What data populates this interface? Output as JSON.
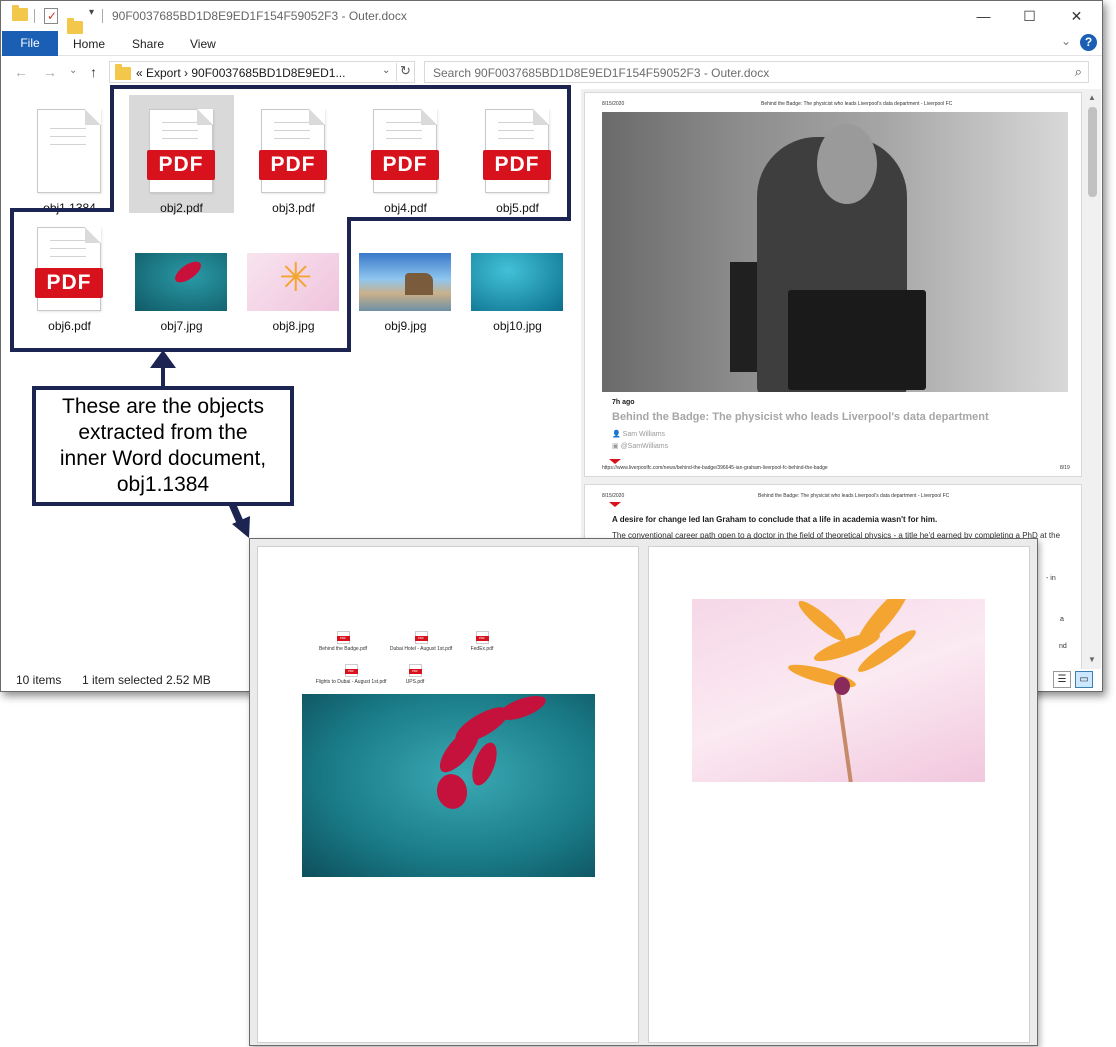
{
  "window": {
    "title": "90F0037685BD1D8E9ED1F154F59052F3 - Outer.docx",
    "controls": {
      "minimize": "—",
      "maximize": "☐",
      "close": "✕"
    }
  },
  "ribbon": {
    "file": "File",
    "tabs": [
      "Home",
      "Share",
      "View"
    ],
    "help": "?",
    "expand": "⌄"
  },
  "nav": {
    "back": "←",
    "forward": "→",
    "dropdown": "⌄",
    "up": "↑",
    "address": "«  Export  ›  90F0037685BD1D8E9ED1...",
    "search_placeholder": "Search 90F0037685BD1D8E9ED1F154F59052F3 - Outer.docx"
  },
  "files": [
    {
      "name": "obj1.1384",
      "kind": "doc"
    },
    {
      "name": "obj2.pdf",
      "kind": "pdf",
      "selected": true
    },
    {
      "name": "obj3.pdf",
      "kind": "pdf"
    },
    {
      "name": "obj4.pdf",
      "kind": "pdf"
    },
    {
      "name": "obj5.pdf",
      "kind": "pdf"
    },
    {
      "name": "obj6.pdf",
      "kind": "pdf"
    },
    {
      "name": "obj7.jpg",
      "kind": "jpg"
    },
    {
      "name": "obj8.jpg",
      "kind": "jpg"
    },
    {
      "name": "obj9.jpg",
      "kind": "jpg"
    },
    {
      "name": "obj10.jpg",
      "kind": "jpg"
    }
  ],
  "pdf_badge": "PDF",
  "status": {
    "count": "10 items",
    "selection": "1 item selected  2.52 MB"
  },
  "preview": {
    "page1": {
      "date": "8/15/2020",
      "header": "Behind the Badge: The physicist who leads Liverpool's data department - Liverpool FC",
      "ago": "7h ago",
      "title": "Behind the Badge: The physicist who leads Liverpool's data department",
      "author": "Sam Williams",
      "handle": "@SamWilliams",
      "url": "https://www.liverpoolfc.com/news/behind-the-badge/396645-ian-graham-liverpool-fc-behind-the-badge",
      "page_num": "8/19"
    },
    "page2": {
      "date": "8/15/2020",
      "header": "Behind the Badge: The physicist who leads Liverpool's data department - Liverpool FC",
      "lead": "A desire for change led Ian Graham to conclude that a life in academia wasn't for him.",
      "body": "The conventional career path open to a doctor in the field of theoretical physics - a title he'd earned by completing a PhD at the",
      "frag1": "- in",
      "frag2": "a",
      "frag3": "nd"
    }
  },
  "callout": {
    "lines": [
      "These are the objects",
      "extracted from the",
      "inner Word document,",
      "obj1.1384"
    ]
  },
  "inner_doc": {
    "embedded": [
      "Behind the Badge.pdf",
      "Dubai Hotel - August 1st.pdf",
      "FedEx.pdf",
      "Flights to Dubai - August 1st.pdf",
      "UPS.pdf"
    ]
  },
  "colors": {
    "annotation": "#1c2552",
    "file_tab": "#1a5fb4",
    "pdf_red": "#d7121c"
  }
}
